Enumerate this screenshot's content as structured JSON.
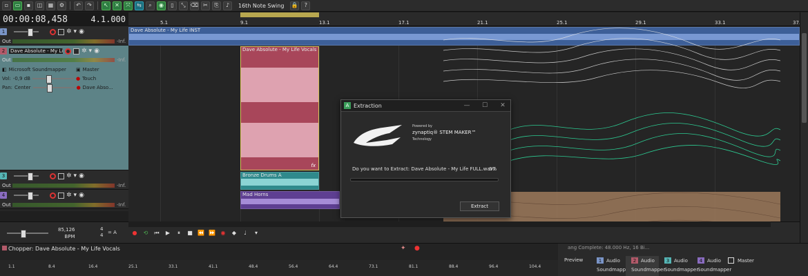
{
  "toolbar": {
    "groove_label": "16th Note Swing"
  },
  "time": {
    "position": "00:00:08,458",
    "bars_beats": "4.1.000"
  },
  "tracks": [
    {
      "num": "1",
      "color_class": "c1",
      "name": "",
      "out": "Out",
      "inf": "-Inf."
    },
    {
      "num": "2",
      "color_class": "c2",
      "name": "Dave Absolute - My Life ...",
      "out": "Out",
      "inf": "-Inf.",
      "output_device": "Microsoft Soundmapper",
      "master": "Master",
      "vol_label": "Vol:",
      "vol_value": "-0,9 dB",
      "touch": "Touch",
      "pan_label": "Pan:",
      "pan_value": "Center",
      "pan_target": "Dave Abso..."
    },
    {
      "num": "3",
      "color_class": "c3",
      "name": "",
      "out": "Out",
      "inf": "-Inf."
    },
    {
      "num": "4",
      "color_class": "c4",
      "name": "",
      "out": "Out",
      "inf": "-Inf."
    }
  ],
  "ruler": {
    "ticks": [
      "5.1",
      "9.1",
      "13.1",
      "17.1",
      "21.1",
      "25.1",
      "29.1",
      "33.1",
      "37.1"
    ]
  },
  "clips": {
    "full_track": "Dave Absolute - My Life INST",
    "vocals": "Dave Absolute - My Life Vocals",
    "drums": "Bronze Drums A",
    "horns": "Mad Horns"
  },
  "colors": {
    "accent": "#4caf50",
    "vocals_clip": "#b04b5c",
    "full_track_clip": "#4c6fa8",
    "drums_clip": "#3a9ea0",
    "horns_clip": "#6e4fa0",
    "stem_white": "#e8e8e8",
    "stem_green": "#26d68e",
    "stem_brown": "#b08a6a"
  },
  "dialog": {
    "title": "Extraction",
    "powered_by": "Powered by",
    "brand": "zynaptiq® STEM MAKER™",
    "technology": "Technology",
    "question": "Do you want to Extract: Dave Absolute - My Life FULL.wav?",
    "percent": "0%",
    "progress": 0,
    "extract_button": "Extract"
  },
  "transport": {
    "tempo": "85,126",
    "bpm": "BPM",
    "sig_top": "4",
    "sig_bottom": "4",
    "sig_a": "= A"
  },
  "chopper": {
    "title": "Chopper: Dave Absolute - My Life Vocals",
    "ticks": [
      "1.1",
      "8.4",
      "16.4",
      "25.1",
      "33.1",
      "41.1",
      "48.4",
      "56.4",
      "64.4",
      "73.1",
      "81.1",
      "88.4",
      "96.4",
      "104.4"
    ]
  },
  "mixer": {
    "info_line": "ang Complete: 48.000 Hz, 16 Bi...",
    "preview": "Preview",
    "strips": [
      {
        "num": "1",
        "name": "Audio",
        "sub": "Soundmapper",
        "color": "#7a95c8"
      },
      {
        "num": "2",
        "name": "Audio",
        "sub": "Soundmapper",
        "color": "#b35a6a"
      },
      {
        "num": "3",
        "name": "Audio",
        "sub": "Soundmapper",
        "color": "#55b5b5"
      },
      {
        "num": "4",
        "name": "Audio",
        "sub": "Soundmapper",
        "color": "#8a6cc0"
      }
    ],
    "master": "Master"
  }
}
